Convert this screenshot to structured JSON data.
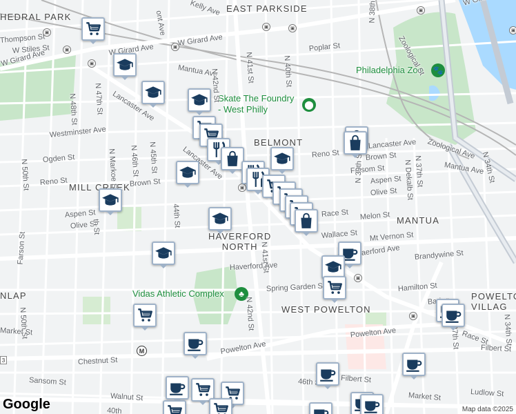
{
  "map": {
    "attribution": "Map data ©2025",
    "logo": "Google",
    "colors": {
      "background": "#f1f3f4",
      "park": "#c8e6c9",
      "water": "#aadaff",
      "road": "#ffffff",
      "rail": "#b0b0b0",
      "pin_icon": "#1a3c5e",
      "poi_green": "#1e8e3e"
    }
  },
  "neighborhoods": [
    {
      "id": "east-parkside",
      "text": "EAST PARKSIDE"
    },
    {
      "id": "belmont",
      "text": "BELMONT"
    },
    {
      "id": "mill-creek",
      "text": "MILL CREEK"
    },
    {
      "id": "haverford-north",
      "text": "HAVERFORD\nNORTH"
    },
    {
      "id": "mantua",
      "text": "MANTUA"
    },
    {
      "id": "west-powelton",
      "text": "WEST POWELTON"
    },
    {
      "id": "powelton-village",
      "text": "POWELTO\nVILLAG"
    },
    {
      "id": "cathedral-park",
      "text": "HEDRAL PARK"
    },
    {
      "id": "dunlap",
      "text": "NLAP"
    }
  ],
  "pois": {
    "skate": "Skate The Foundry\n- West Philly",
    "zoo": "Philadelphia Zoo",
    "vidas": "Vidas Athletic Complex"
  },
  "streets": [
    {
      "id": "w-girard-ave-1",
      "text": "W Girard Ave"
    },
    {
      "id": "w-girard-ave-2",
      "text": "W Girard Ave"
    },
    {
      "id": "w-girard-ave-3",
      "text": "W Girard Ave"
    },
    {
      "id": "w-girard-ave-4",
      "text": "W Girard Ave"
    },
    {
      "id": "thompson-st",
      "text": "Thompson St"
    },
    {
      "id": "w-stiles-st",
      "text": "W Stiles St"
    },
    {
      "id": "kelly-ave",
      "text": "Kelly Ave"
    },
    {
      "id": "mont-ave",
      "text": "ont Ave"
    },
    {
      "id": "mantua-ave-1",
      "text": "Mantua Ave"
    },
    {
      "id": "mantua-ave-2",
      "text": "Mantua Ave"
    },
    {
      "id": "poplar-st",
      "text": "Poplar St"
    },
    {
      "id": "n-38th-st",
      "text": "N 38th St"
    },
    {
      "id": "n-42nd-st-1",
      "text": "N 42nd St"
    },
    {
      "id": "n-42nd-st-2",
      "text": "N 42nd St"
    },
    {
      "id": "n-41st-st-1",
      "text": "N 41st St"
    },
    {
      "id": "n-41st-st-2",
      "text": "N 41st St"
    },
    {
      "id": "n-40th-st",
      "text": "N 40th St"
    },
    {
      "id": "zoological-st",
      "text": "Zoological St"
    },
    {
      "id": "zoological-ave",
      "text": "Zoological Ave"
    },
    {
      "id": "lancaster-ave-1",
      "text": "Lancaster Ave"
    },
    {
      "id": "lancaster-ave-2",
      "text": "Lancaster Ave"
    },
    {
      "id": "lancaster-ave-3",
      "text": "Lancaster Ave"
    },
    {
      "id": "n-48th-st",
      "text": "N 48th St"
    },
    {
      "id": "n-47th-st",
      "text": "N 47th St"
    },
    {
      "id": "n-46th-st",
      "text": "N 46th St"
    },
    {
      "id": "n-45th-st",
      "text": "N 45th St"
    },
    {
      "id": "n-markoe-st",
      "text": "N Markoe St"
    },
    {
      "id": "n-44th-st",
      "text": "44th St"
    },
    {
      "id": "westminster-ave",
      "text": "Westminster Ave"
    },
    {
      "id": "ogden-st",
      "text": "Ogden St"
    },
    {
      "id": "n-50th-st-1",
      "text": "N 50th St"
    },
    {
      "id": "n-50th-st-2",
      "text": "N 50th St"
    },
    {
      "id": "reno-st-1",
      "text": "Reno St"
    },
    {
      "id": "reno-st-2",
      "text": "Reno St"
    },
    {
      "id": "brown-st-1",
      "text": "Brown St"
    },
    {
      "id": "brown-st-2",
      "text": "Brown St"
    },
    {
      "id": "aspen-st-1",
      "text": "Aspen St"
    },
    {
      "id": "aspen-st-2",
      "text": "Aspen St"
    },
    {
      "id": "olive-st-1",
      "text": "Olive St"
    },
    {
      "id": "olive-st-2",
      "text": "Olive St"
    },
    {
      "id": "n-49th-st",
      "text": "th St"
    },
    {
      "id": "folsom-st",
      "text": "Folsom St"
    },
    {
      "id": "n-39th-st",
      "text": "N 39th St"
    },
    {
      "id": "n-dekalb-st",
      "text": "N Dekalb St"
    },
    {
      "id": "n-37th-st-1",
      "text": "N 37th St"
    },
    {
      "id": "n-37th-st-2",
      "text": "N 37th St"
    },
    {
      "id": "n-34th-st-1",
      "text": "N 34th St"
    },
    {
      "id": "n-34th-st-2",
      "text": "N 34th St"
    },
    {
      "id": "mantua-ave-3",
      "text": "Mantua Ave"
    },
    {
      "id": "reno-st-3",
      "text": "no St"
    },
    {
      "id": "mount-ave",
      "text": "unt Ave"
    },
    {
      "id": "melon-st",
      "text": "Melon St"
    },
    {
      "id": "wallace-st",
      "text": "Wallace St"
    },
    {
      "id": "mt-vernon-st",
      "text": "Mt Vernon St"
    },
    {
      "id": "haverford-ave-1",
      "text": "Haverford Ave"
    },
    {
      "id": "haverford-ave-2",
      "text": "aerford Ave"
    },
    {
      "id": "brandywine-st",
      "text": "Brandywine St"
    },
    {
      "id": "farson-st",
      "text": "Farson St"
    },
    {
      "id": "spring-garden-st",
      "text": "Spring Garden St"
    },
    {
      "id": "hamilton-st",
      "text": "Hamilton St"
    },
    {
      "id": "baring-st",
      "text": "Baring"
    },
    {
      "id": "market-st-1",
      "text": "Market St"
    },
    {
      "id": "market-st-2",
      "text": "Market St"
    },
    {
      "id": "powelton-ave-1",
      "text": "Powelton Ave"
    },
    {
      "id": "powelton-ave-2",
      "text": "Powelton Ave"
    },
    {
      "id": "lancaster-ave-4",
      "text": "Lancaster Ave"
    },
    {
      "id": "race-st",
      "text": "Race St"
    },
    {
      "id": "filbert-st-1",
      "text": "Filbert St"
    },
    {
      "id": "filbert-st-2",
      "text": "Filbert St"
    },
    {
      "id": "ludlow-st",
      "text": "Ludlow St"
    },
    {
      "id": "chestnut-st",
      "text": "Chestnut St"
    },
    {
      "id": "sansom-st",
      "text": "Sansom St"
    },
    {
      "id": "walnut-st",
      "text": "Walnut St"
    },
    {
      "id": "n-40th-st-2",
      "text": "40th"
    },
    {
      "id": "46th-st-station",
      "text": "46th St"
    }
  ],
  "pins": [
    {
      "id": "grocery-1",
      "icon": "grocery-cart-icon"
    },
    {
      "id": "school-1",
      "icon": "graduation-cap-icon"
    },
    {
      "id": "school-2",
      "icon": "graduation-cap-icon"
    },
    {
      "id": "school-3",
      "icon": "graduation-cap-icon"
    },
    {
      "id": "grocery-2",
      "icon": "grocery-cart-icon"
    },
    {
      "id": "grocery-3",
      "icon": "grocery-cart-icon"
    },
    {
      "id": "restaurant-1",
      "icon": "fork-knife-icon"
    },
    {
      "id": "shopping-1",
      "icon": "shopping-bag-icon"
    },
    {
      "id": "restaurant-2",
      "icon": "fork-knife-icon"
    },
    {
      "id": "school-4",
      "icon": "graduation-cap-icon"
    },
    {
      "id": "shopping-2",
      "icon": "shopping-bag-icon"
    },
    {
      "id": "school-5",
      "icon": "graduation-cap-icon"
    },
    {
      "id": "restaurant-3",
      "icon": "fork-knife-icon"
    },
    {
      "id": "grocery-4",
      "icon": "grocery-cart-icon"
    },
    {
      "id": "stack-1",
      "icon": "grocery-cart-icon"
    },
    {
      "id": "stack-2",
      "icon": "grocery-cart-icon"
    },
    {
      "id": "stack-3",
      "icon": "grocery-cart-icon"
    },
    {
      "id": "stack-4",
      "icon": "grocery-cart-icon"
    },
    {
      "id": "stack-5",
      "icon": "shopping-bag-icon"
    },
    {
      "id": "school-6",
      "icon": "graduation-cap-icon"
    },
    {
      "id": "school-7",
      "icon": "graduation-cap-icon"
    },
    {
      "id": "school-8",
      "icon": "graduation-cap-icon"
    },
    {
      "id": "cafe-1",
      "icon": "coffee-cup-icon"
    },
    {
      "id": "school-9",
      "icon": "graduation-cap-icon"
    },
    {
      "id": "grocery-5",
      "icon": "grocery-cart-icon"
    },
    {
      "id": "grocery-6",
      "icon": "grocery-cart-icon"
    },
    {
      "id": "cafe-2",
      "icon": "coffee-cup-icon"
    },
    {
      "id": "cafe-3",
      "icon": "coffee-cup-icon"
    },
    {
      "id": "cafe-4",
      "icon": "coffee-cup-icon"
    },
    {
      "id": "cafe-5",
      "icon": "coffee-cup-icon"
    },
    {
      "id": "cafe-6",
      "icon": "coffee-cup-icon"
    },
    {
      "id": "grocery-7",
      "icon": "grocery-cart-icon"
    },
    {
      "id": "grocery-8",
      "icon": "grocery-cart-icon"
    },
    {
      "id": "grocery-9",
      "icon": "grocery-cart-icon"
    },
    {
      "id": "cafe-7",
      "icon": "coffee-cup-icon"
    },
    {
      "id": "grocery-10",
      "icon": "grocery-cart-icon"
    },
    {
      "id": "cafe-8",
      "icon": "coffee-cup-icon"
    },
    {
      "id": "cafe-9",
      "icon": "coffee-cup-icon"
    },
    {
      "id": "cafe-10",
      "icon": "coffee-cup-icon"
    },
    {
      "id": "shopping-3",
      "icon": "shopping-bag-icon"
    }
  ]
}
